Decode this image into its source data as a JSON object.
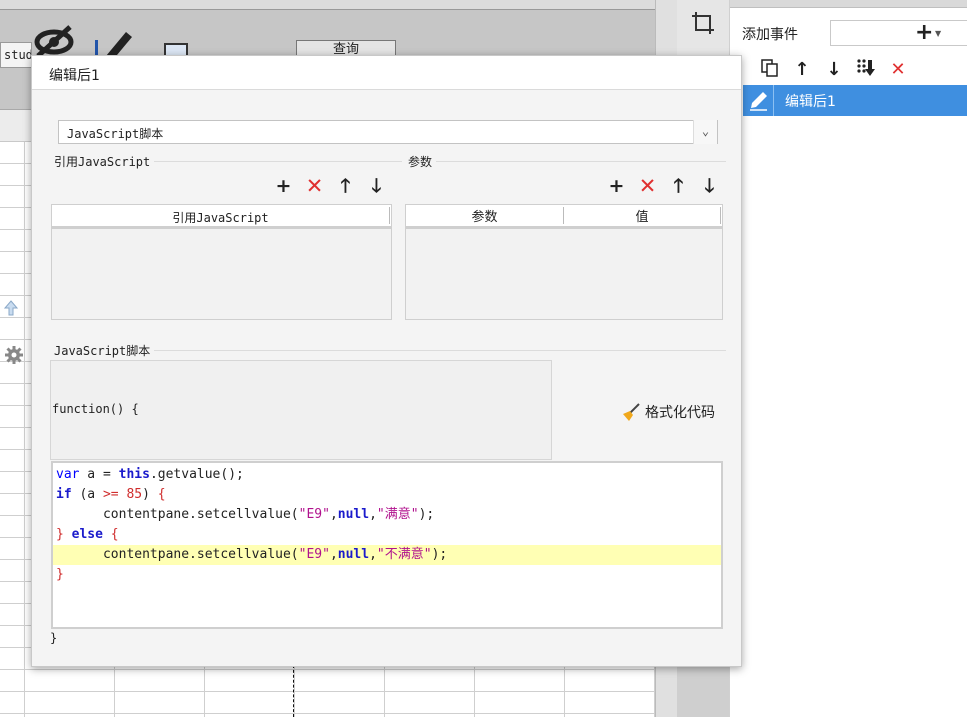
{
  "designer": {
    "stud_label": "stud",
    "query_label": "查询"
  },
  "events_panel": {
    "add_event_label": "添加事件",
    "add_icon": "+",
    "toolbar": [
      {
        "icon": "copy-icon",
        "glyph": "⧉"
      },
      {
        "icon": "move-up-icon",
        "glyph": "↑"
      },
      {
        "icon": "move-down-icon",
        "glyph": "↓"
      },
      {
        "icon": "sort-icon",
        "glyph": "⇣"
      },
      {
        "icon": "delete-icon",
        "glyph": "✕",
        "color": "#e03030"
      }
    ],
    "items": [
      {
        "label": "编辑后1",
        "selected": true
      }
    ],
    "accent_color": "#3f8fe0"
  },
  "dialog": {
    "title": "编辑后1",
    "script_type": "JavaScript脚本",
    "refs_group": {
      "title": "引用JavaScript",
      "column_header": "引用JavaScript"
    },
    "params_group": {
      "title": "参数",
      "columns": [
        "参数",
        "值"
      ]
    },
    "icon_glyphs": {
      "add": "+",
      "delete": "✕",
      "up": "🡑",
      "down": "🡓"
    },
    "script_group_title": "JavaScript脚本",
    "function_header": "function() {",
    "format_code_label": "格式化代码",
    "function_footer": "}",
    "code_lines": [
      "var a = this.getvalue();",
      "if (a >= 85) {",
      "    contentpane.setcellvalue(\"E9\",null,\"满意\");",
      "} else {",
      "    contentpane.setcellvalue(\"E9\",null,\"不满意\");",
      "}"
    ],
    "highlighted_line": 5
  }
}
